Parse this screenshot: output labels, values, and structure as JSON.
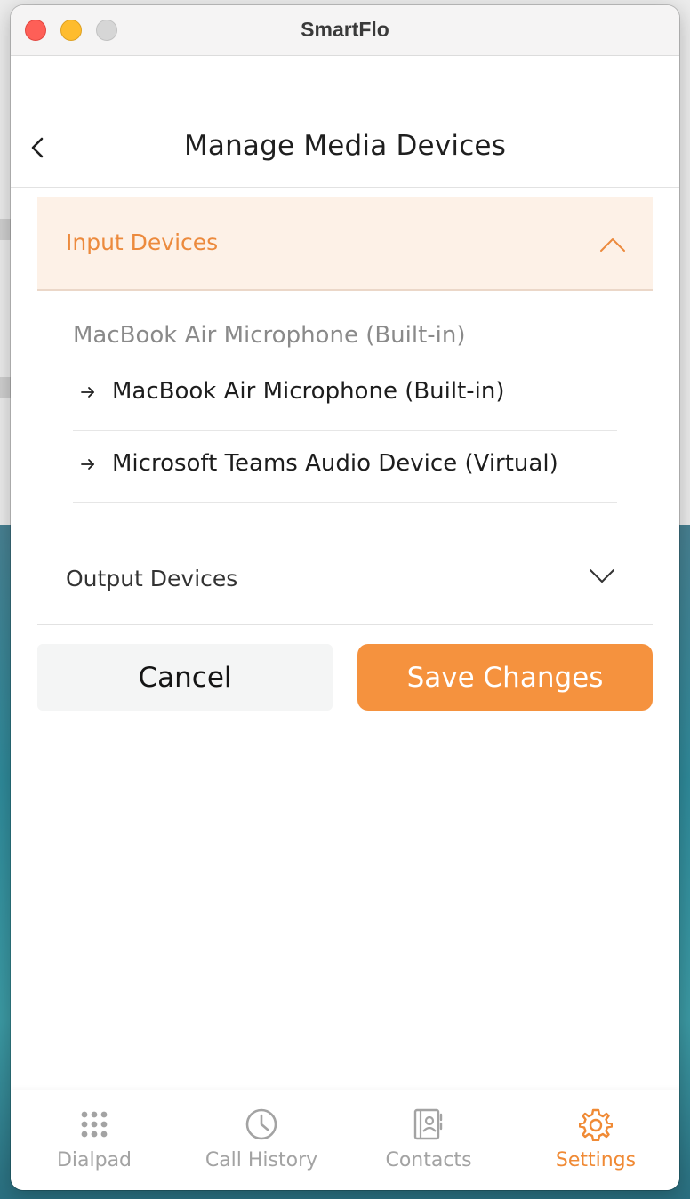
{
  "window": {
    "title": "SmartFlo"
  },
  "header": {
    "title": "Manage Media Devices"
  },
  "input_devices": {
    "label": "Input Devices",
    "expanded": true,
    "selected": "MacBook Air Microphone (Built-in)",
    "options": [
      "MacBook Air Microphone (Built-in)",
      "Microsoft Teams Audio Device (Virtual)"
    ]
  },
  "output_devices": {
    "label": "Output Devices",
    "expanded": false
  },
  "actions": {
    "cancel": "Cancel",
    "save": "Save Changes"
  },
  "nav": {
    "items": [
      {
        "label": "Dialpad",
        "icon": "dialpad-icon"
      },
      {
        "label": "Call History",
        "icon": "clock-icon"
      },
      {
        "label": "Contacts",
        "icon": "contacts-icon"
      },
      {
        "label": "Settings",
        "icon": "gear-icon"
      }
    ],
    "active": "Settings"
  },
  "colors": {
    "accent": "#f5923e",
    "accent_text": "#ec8a3d",
    "section_bg": "#fdf1e7",
    "muted": "#a3a3a3"
  }
}
